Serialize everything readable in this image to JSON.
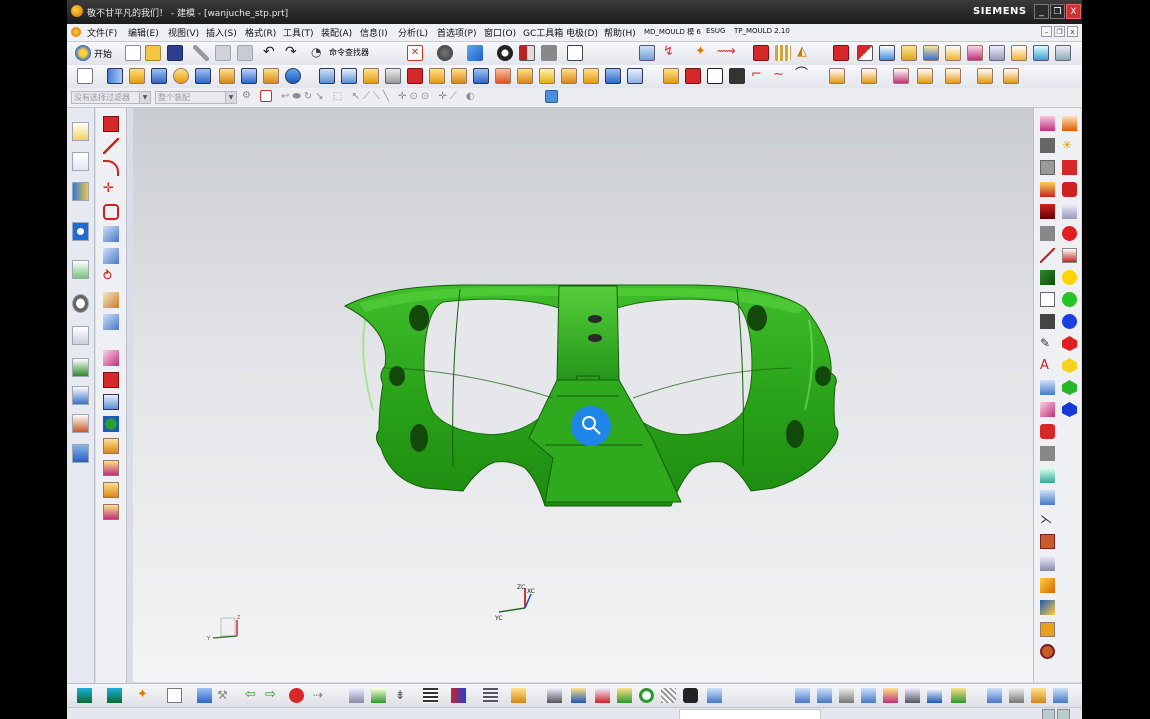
{
  "window": {
    "title": "敬不甘平凡的我们！ - 建模 - [wanjuche_stp.prt]",
    "brand": "SIEMENS",
    "buttons": {
      "minimize": "_",
      "restore": "❐",
      "close": "X"
    }
  },
  "menu": {
    "items": [
      "文件(F)",
      "编辑(E)",
      "视图(V)",
      "插入(S)",
      "格式(R)",
      "工具(T)",
      "装配(A)",
      "信息(I)",
      "分析(L)",
      "首选项(P)",
      "窗口(O)",
      "GC工具箱",
      "电极(D)",
      "帮助(H)",
      "MD_MOULD 模 6",
      "ESUG",
      "TP_MOULD 2.10"
    ]
  },
  "toolbar": {
    "start_label": "开始",
    "command_finder_label": "命令查找器",
    "selection_filter": "没有选择过滤器",
    "assembly_scope": "整个装配"
  },
  "viewport": {
    "triad_main": {
      "z": "ZC",
      "y": "YC",
      "x": "XC"
    },
    "triad_corner": {
      "z": "Z",
      "y": "Y",
      "x": "X"
    },
    "part_color": "#2ea31c",
    "cursor_icon": "zoom-magnifier-icon",
    "cursor_color": "#1f86e8"
  },
  "colors": {
    "title_bg": "#262626",
    "accent_red": "#d61f1f",
    "palette": [
      "#e02020",
      "#ffd400",
      "#27c427",
      "#1a3fe0",
      "#e02020",
      "#f5d31c",
      "#2bb52b",
      "#1638d8"
    ]
  }
}
